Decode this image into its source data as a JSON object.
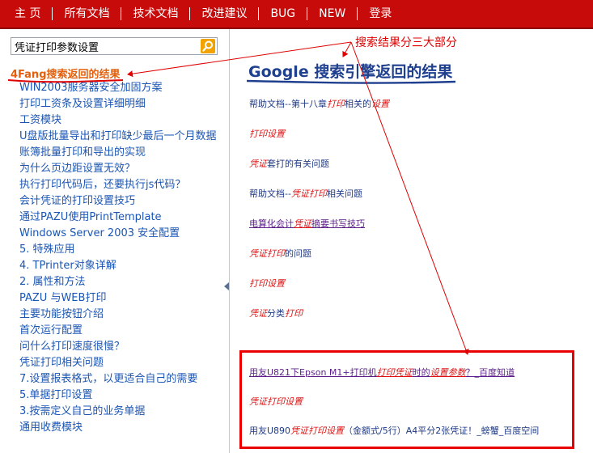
{
  "nav": {
    "items": [
      "主 页",
      "所有文档",
      "技术文档",
      "改进建议",
      "BUG",
      "NEW",
      "登录"
    ]
  },
  "search": {
    "value": "凭证打印参数设置",
    "button_icon": "search-icon"
  },
  "left": {
    "section_title": "4Fang搜索返回的结果",
    "docs": [
      "WIN2003服务器安全加固方案",
      "打印工资条及设置详细明细",
      "工资模块",
      "U盘版批量导出和打印缺少最后一个月数据",
      "账簿批量打印和导出的实现",
      "为什么页边距设置无效？",
      "执行打印代码后，还要执行js代码？",
      "会计凭证的打印设置技巧",
      "通过PAZU使用PrintTemplate",
      "Windows Server 2003 安全配置",
      "5. 特殊应用",
      "4. TPrinter对象详解",
      "2. 属性和方法",
      "PAZU 与WEB打印",
      "主要功能按钮介绍",
      "首次运行配置",
      "问什么打印速度很慢？",
      "凭证打印相关问题",
      "7.设置报表格式，以更适合自己的需要",
      "5.单据打印设置",
      "3.按需定义自己的业务单据",
      "通用收费模块"
    ]
  },
  "right": {
    "title": "Google 搜索引擎返回的结果",
    "annotation": "搜索结果分三大部分",
    "results": [
      {
        "parts": [
          [
            "帮助文档--第十八章",
            ""
          ],
          [
            "打印",
            "hl"
          ],
          [
            "相关的",
            ""
          ],
          [
            "设置",
            "hl"
          ]
        ]
      },
      {
        "parts": [
          [
            "打印设置",
            "hl"
          ]
        ]
      },
      {
        "parts": [
          [
            "凭证",
            "hl"
          ],
          [
            "套打的有关问题",
            ""
          ]
        ]
      },
      {
        "parts": [
          [
            "帮助文档--",
            ""
          ],
          [
            "凭证打印",
            "hl"
          ],
          [
            "相关问题",
            ""
          ]
        ]
      },
      {
        "parts": [
          [
            "电算化会计",
            ""
          ],
          [
            "凭证",
            "hl"
          ],
          [
            "摘要书写技巧",
            ""
          ]
        ]
      },
      {
        "parts": [
          [
            "凭证打印",
            "hl"
          ],
          [
            "的问题",
            ""
          ]
        ]
      },
      {
        "parts": [
          [
            "打印设置",
            "hl"
          ]
        ]
      },
      {
        "parts": [
          [
            "凭证",
            "hl"
          ],
          [
            "分类",
            ""
          ],
          [
            "打印",
            "hl"
          ]
        ]
      }
    ],
    "baidu_results": [
      {
        "parts": [
          [
            "用友U821下Epson M1+打印机",
            ""
          ],
          [
            "打印凭证",
            "hl"
          ],
          [
            "时的",
            ""
          ],
          [
            "设置参数",
            "hl"
          ],
          [
            "？_百度知道",
            ""
          ]
        ]
      },
      {
        "parts": [
          [
            "凭证打印设置",
            "hl"
          ]
        ]
      },
      {
        "parts": [
          [
            "用友U890",
            ""
          ],
          [
            "凭证打印设置",
            "hl"
          ],
          [
            "（金额式/5行）A4平分2张凭证！_螃蟹_百度空间",
            ""
          ]
        ]
      }
    ]
  },
  "colors": {
    "nav_bg": "#c70b0b",
    "accent_orange": "#e2600e",
    "link_blue": "#1a55b4",
    "title_blue": "#1f3f8f",
    "highlight_red": "#dd1111",
    "annotation_red": "#e00000"
  }
}
